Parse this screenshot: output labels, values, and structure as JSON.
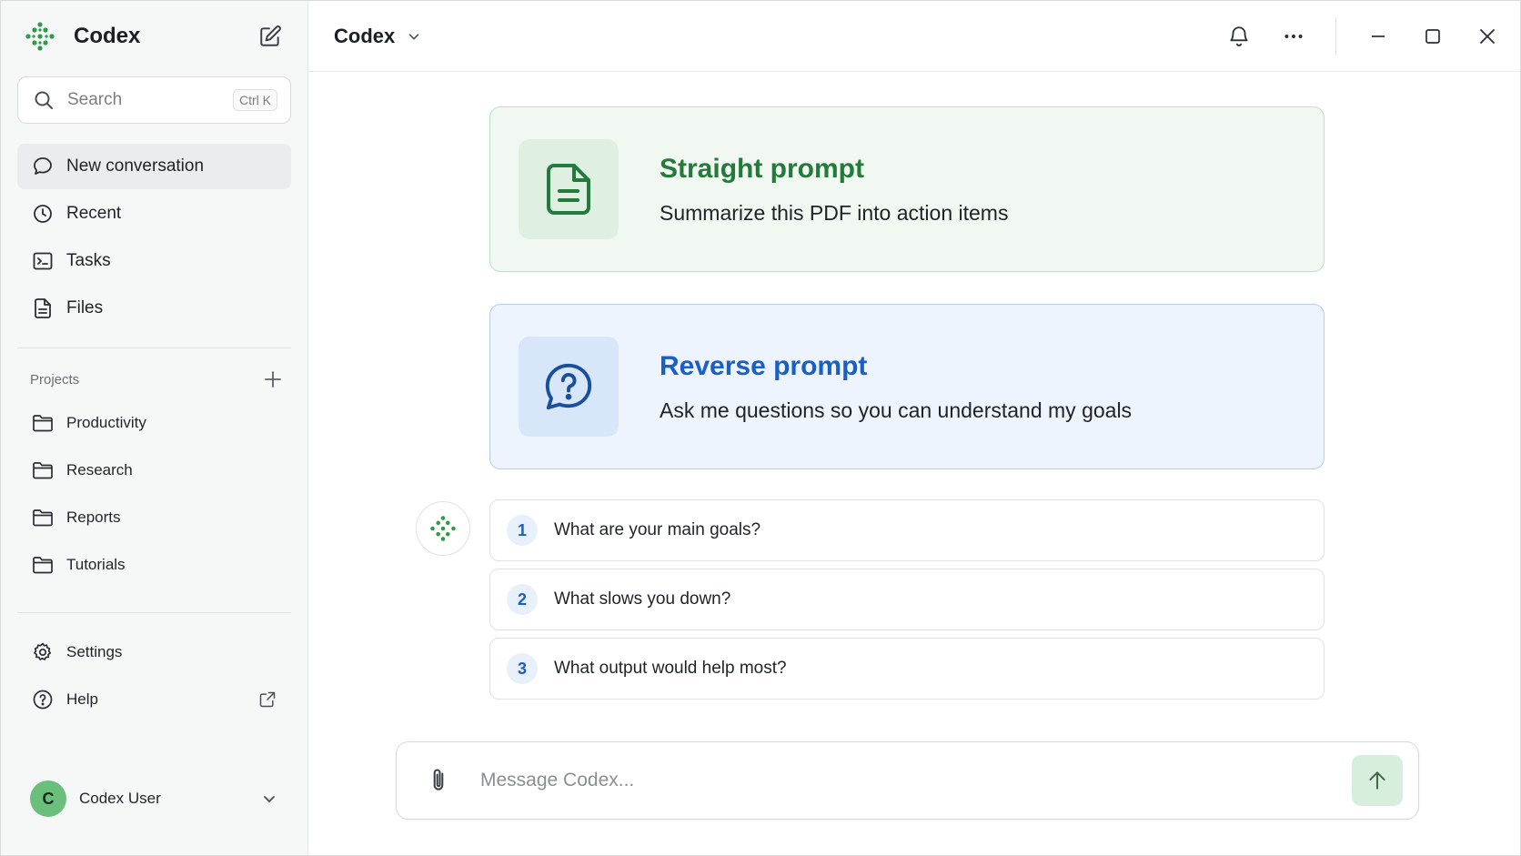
{
  "sidebar": {
    "app_name": "Codex",
    "search": {
      "placeholder": "Search",
      "shortcut": "Ctrl K"
    },
    "nav": [
      {
        "label": "New conversation",
        "icon": "chat-bubble-icon"
      },
      {
        "label": "Recent",
        "icon": "clock-icon"
      },
      {
        "label": "Tasks",
        "icon": "terminal-icon"
      },
      {
        "label": "Files",
        "icon": "file-icon"
      }
    ],
    "projects": {
      "heading": "Projects",
      "items": [
        {
          "label": "Productivity"
        },
        {
          "label": "Research"
        },
        {
          "label": "Reports"
        },
        {
          "label": "Tutorials"
        }
      ]
    },
    "bottom": [
      {
        "label": "Settings",
        "icon": "gear-icon"
      },
      {
        "label": "Help",
        "icon": "help-circle-icon"
      }
    ],
    "user": {
      "initial": "C",
      "name": "Codex User"
    }
  },
  "header": {
    "model_label": "Codex"
  },
  "cards": [
    {
      "title": "Straight prompt",
      "subtitle": "Summarize this PDF into action items",
      "icon": "document-icon"
    },
    {
      "title": "Reverse prompt",
      "subtitle": "Ask me questions so you can understand my goals",
      "icon": "question-bubble-icon"
    }
  ],
  "questions": [
    {
      "num": "1",
      "text": "What are your main goals?"
    },
    {
      "num": "2",
      "text": "What slows you down?"
    },
    {
      "num": "3",
      "text": "What output would help most?"
    }
  ],
  "composer": {
    "placeholder": "Message Codex..."
  },
  "colors": {
    "accent_green": "#237a3a",
    "accent_blue": "#1a5fc5"
  }
}
